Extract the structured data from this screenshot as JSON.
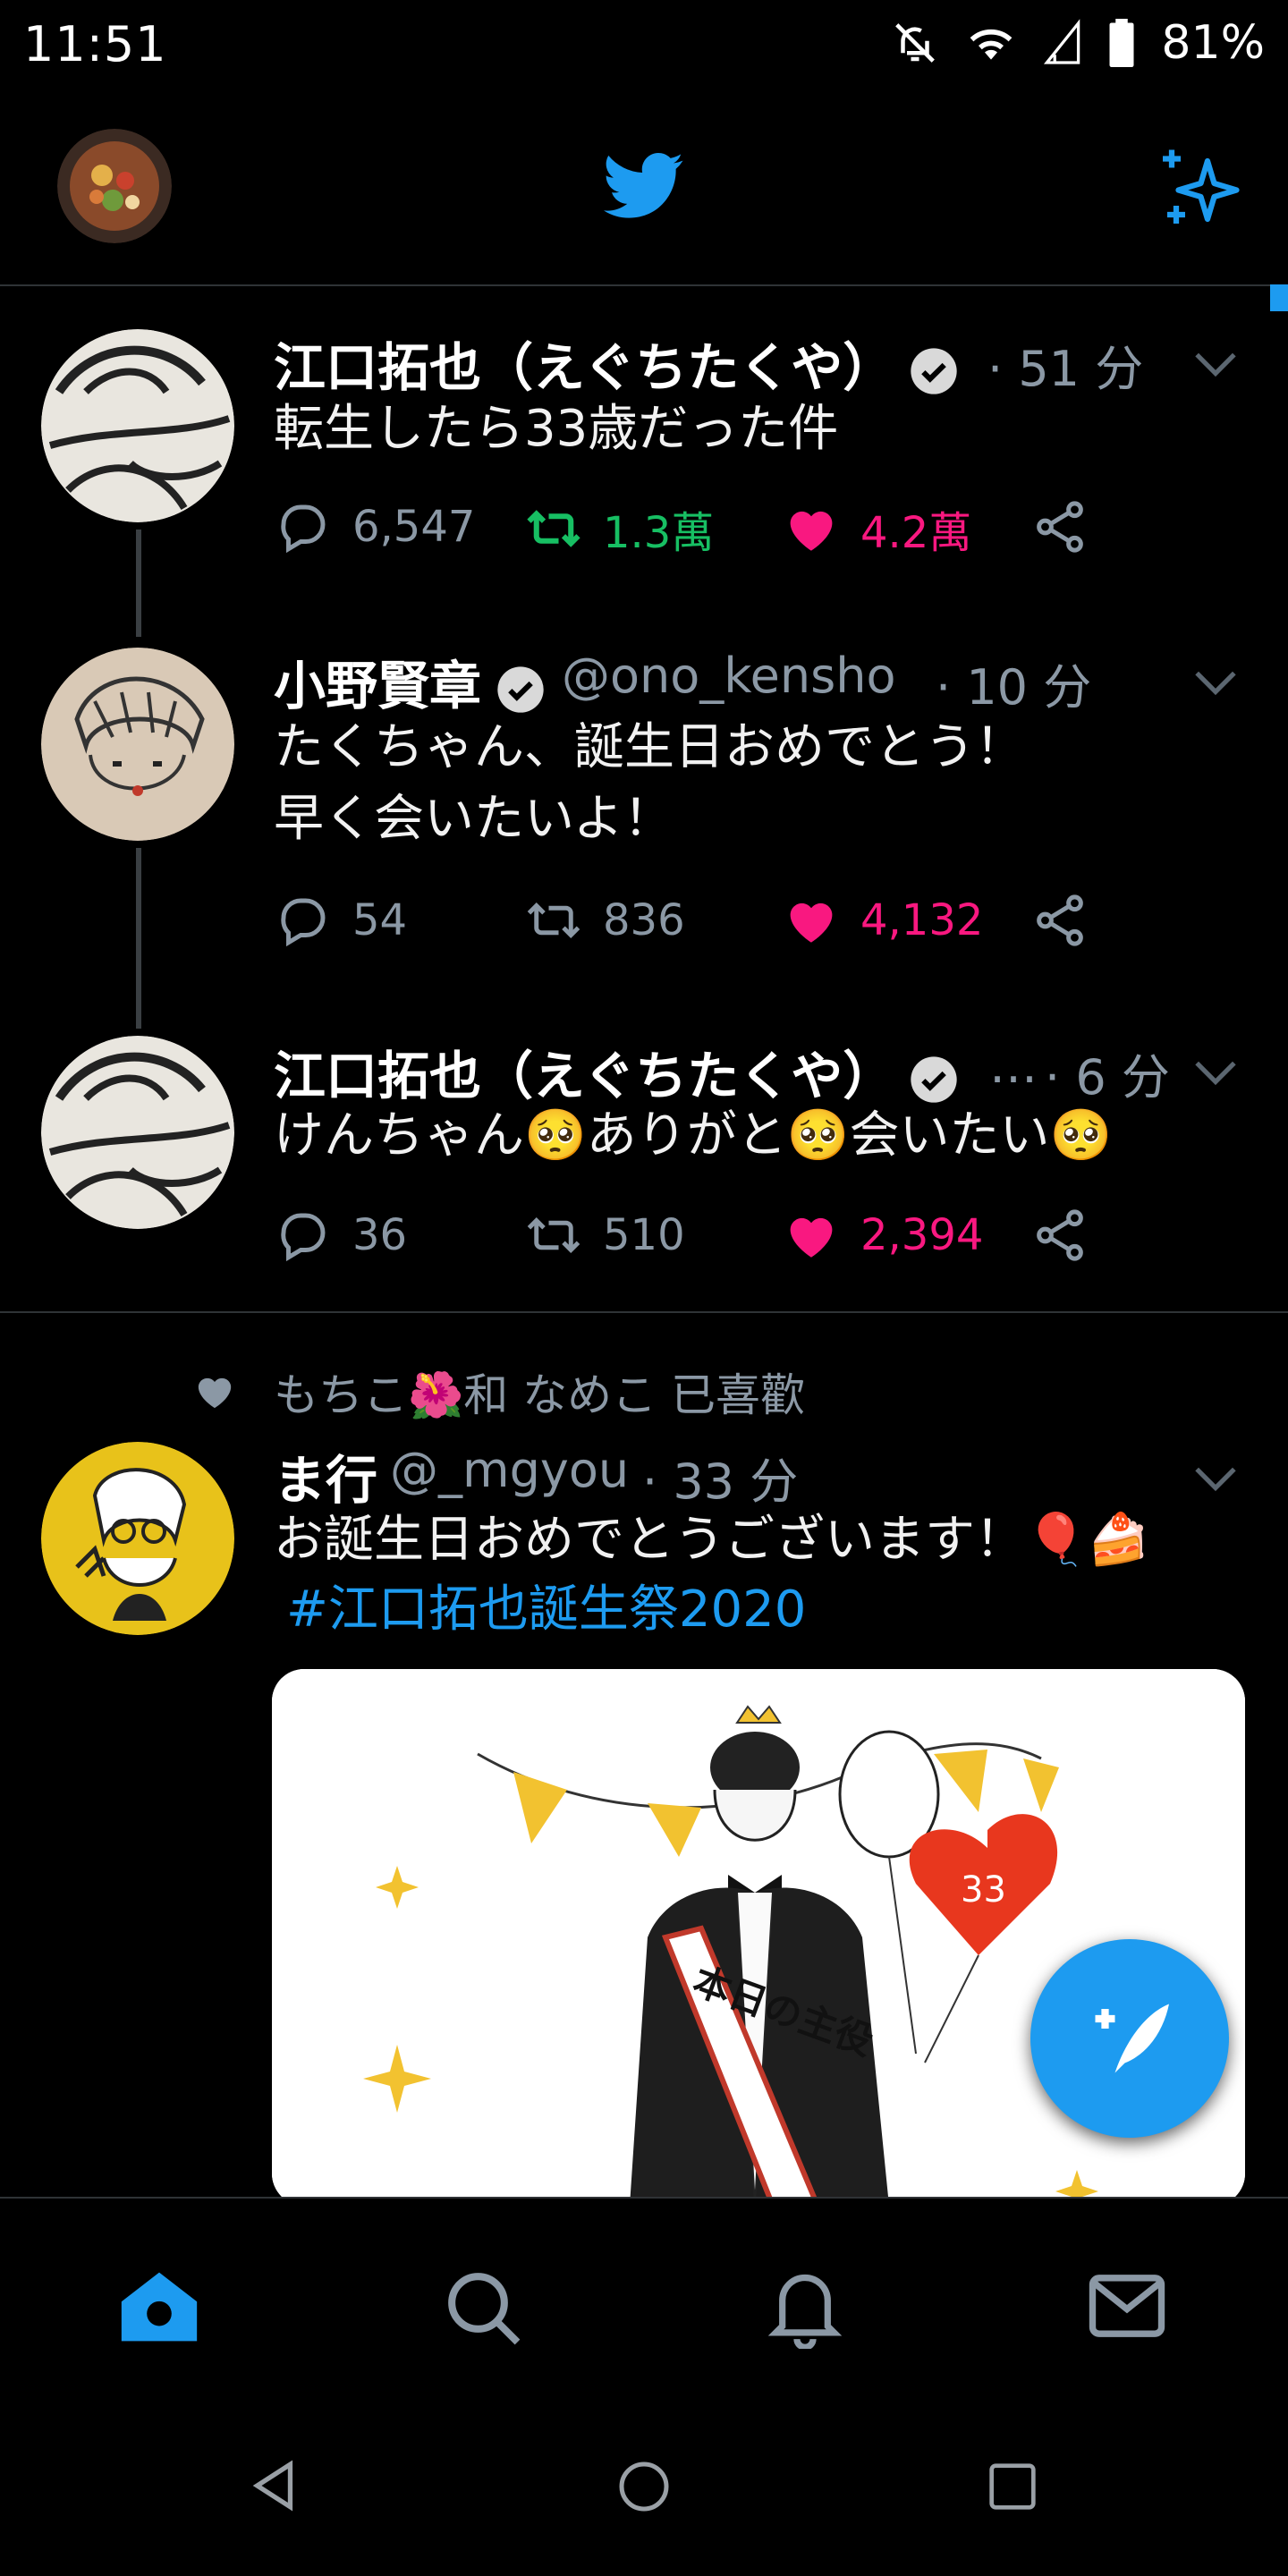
{
  "status_bar": {
    "time": "11:51",
    "battery": "81%",
    "icons": [
      "notifications-off-icon",
      "wifi-icon",
      "signal-icon",
      "battery-icon"
    ]
  },
  "top_bar": {
    "logo": "twitter-bird-icon",
    "right_icon": "sparkle-icon",
    "accent": "#1d9bf0"
  },
  "thread": [
    {
      "name": "江口拓也（えぐちたくや）",
      "verified": true,
      "handle": "",
      "time": "· 51 分",
      "text_lines": [
        "転生したら33歳だった件"
      ],
      "replies": "6,547",
      "retweets": "1.3萬",
      "likes": "4.2萬",
      "retweeted": true,
      "liked": true
    },
    {
      "name": "小野賢章",
      "verified": true,
      "handle": "@ono_kensho",
      "time": "· 10 分",
      "text_lines": [
        "たくちゃん、誕生日おめでとう！",
        "早く会いたいよ！"
      ],
      "replies": "54",
      "retweets": "836",
      "likes": "4,132",
      "retweeted": false,
      "liked": true
    },
    {
      "name": "江口拓也（えぐちたくや）",
      "verified": true,
      "handle": "…",
      "time": "· 6 分",
      "text_lines": [
        "けんちゃん🥺ありがと🥺会いたい🥺"
      ],
      "replies": "36",
      "retweets": "510",
      "likes": "2,394",
      "retweeted": false,
      "liked": true
    }
  ],
  "liked_tweet": {
    "social_context": "もちこ🌺和 なめこ 已喜歡",
    "name": "ま行",
    "handle": "@_mgyou",
    "time": "· 33 分",
    "text": "お誕生日おめでとうございます！🎈🍰",
    "hashtag": "#江口拓也誕生祭2020",
    "image_text": "本日の主役",
    "balloon_text": "33"
  },
  "fab": {
    "icon": "compose-tweet-icon"
  },
  "bottom_nav": [
    "home-icon",
    "search-icon",
    "notifications-icon",
    "messages-icon"
  ],
  "android_nav": [
    "back-icon",
    "home-circle-icon",
    "recents-icon"
  ],
  "colors": {
    "retweet_green": "#17bf63",
    "like_pink": "#f91880",
    "muted": "#8b98a5"
  }
}
